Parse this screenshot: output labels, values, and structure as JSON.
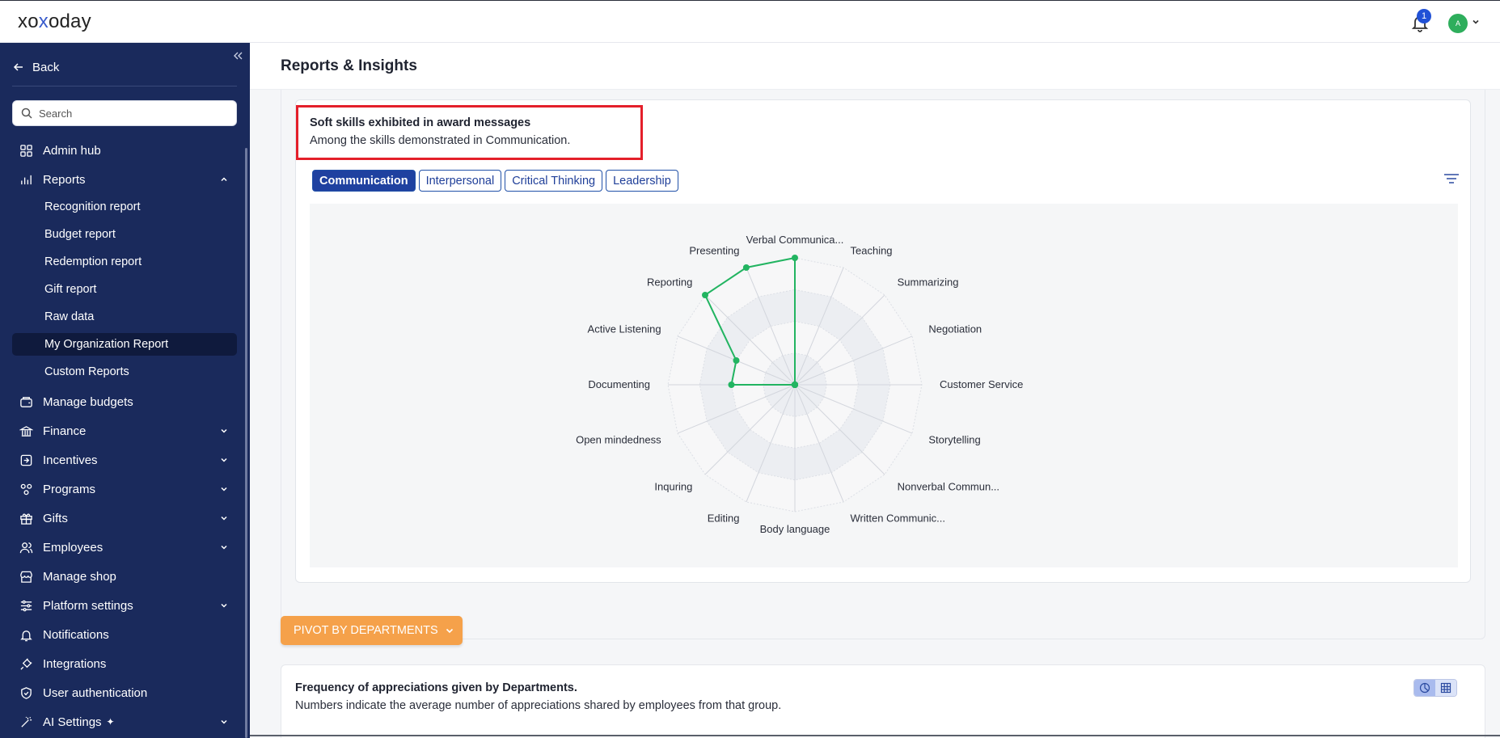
{
  "app": {
    "logo_prefix": "xo",
    "logo_x": "x",
    "logo_suffix": "oday",
    "notification_count": "1",
    "avatar_initial": "A"
  },
  "sidebar": {
    "back_label": "Back",
    "search_placeholder": "Search",
    "items": {
      "admin_hub": "Admin hub",
      "reports": "Reports",
      "recognition_report": "Recognition report",
      "budget_report": "Budget report",
      "redemption_report": "Redemption report",
      "gift_report": "Gift report",
      "raw_data": "Raw data",
      "my_org_report": "My Organization Report",
      "custom_reports": "Custom Reports",
      "manage_budgets": "Manage budgets",
      "finance": "Finance",
      "incentives": "Incentives",
      "programs": "Programs",
      "gifts": "Gifts",
      "employees": "Employees",
      "manage_shop": "Manage shop",
      "platform_settings": "Platform settings",
      "notifications": "Notifications",
      "integrations": "Integrations",
      "user_authentication": "User authentication",
      "ai_settings": "AI Settings"
    }
  },
  "main": {
    "page_title": "Reports & Insights",
    "skills_card": {
      "title": "Soft skills exhibited in award messages",
      "subtitle": "Among the skills demonstrated in Communication."
    },
    "tabs": [
      "Communication",
      "Interpersonal",
      "Critical Thinking",
      "Leadership"
    ],
    "pivot_label": "PIVOT BY DEPARTMENTS",
    "freq_card": {
      "title": "Frequency of appreciations given by Departments.",
      "subtitle": "Numbers indicate the average number of appreciations shared by employees from that group."
    }
  },
  "chart_data": {
    "type": "radar",
    "title": "",
    "axes": [
      "Verbal Communica...",
      "Teaching",
      "Summarizing",
      "Negotiation",
      "Customer Service",
      "Storytelling",
      "Nonverbal Commun...",
      "Written Communic...",
      "Body language",
      "Editing",
      "Inquring",
      "Open mindedness",
      "Documenting",
      "Active Listening",
      "Reporting",
      "Presenting"
    ],
    "series": [
      {
        "values": [
          1.0,
          0,
          0,
          0,
          0,
          0,
          0,
          0,
          0,
          0,
          0,
          0,
          0.5,
          0.5,
          1.0,
          1.0
        ],
        "color": "#22b461"
      }
    ],
    "rlim": [
      0,
      1
    ],
    "rings": 4,
    "grid": true
  }
}
